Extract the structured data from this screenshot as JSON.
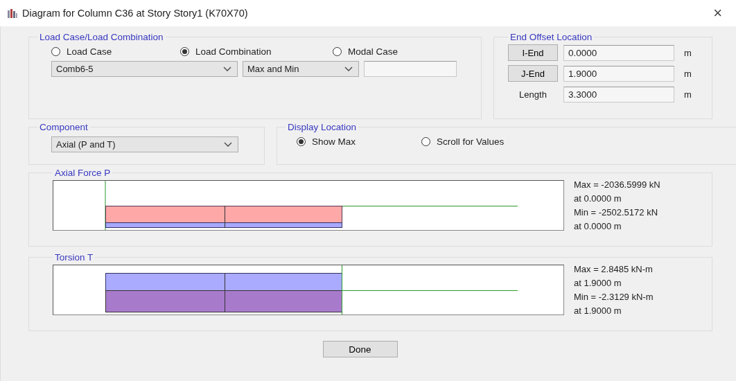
{
  "window": {
    "title": "Diagram for Column C36 at Story Story1 (K70X70)",
    "close": "×"
  },
  "load_case_group": {
    "title": "Load Case/Load Combination",
    "options": [
      {
        "label": "Load Case",
        "selected": false
      },
      {
        "label": "Load Combination",
        "selected": true
      },
      {
        "label": "Modal Case",
        "selected": false
      }
    ],
    "combination": "Comb6-5",
    "mode": "Max and Min"
  },
  "end_offset": {
    "title": "End Offset Location",
    "rows": [
      {
        "kind": "button",
        "label": "I-End",
        "value": "0.0000",
        "unit": "m"
      },
      {
        "kind": "button",
        "label": "J-End",
        "value": "1.9000",
        "unit": "m"
      },
      {
        "kind": "label",
        "label": "Length",
        "value": "3.3000",
        "unit": "m"
      }
    ]
  },
  "component": {
    "title": "Component",
    "value": "Axial (P and T)"
  },
  "display_location": {
    "title": "Display Location",
    "options": [
      {
        "label": "Show Max",
        "selected": true
      },
      {
        "label": "Scroll for Values",
        "selected": false
      }
    ]
  },
  "diagrams": [
    {
      "title": "Axial Force P",
      "kind": "axial",
      "readouts": [
        "Max = -2036.5999 kN",
        "at 0.0000 m",
        "Min = -2502.5172 kN",
        "at 0.0000 m"
      ]
    },
    {
      "title": "Torsion T",
      "kind": "torsion",
      "readouts": [
        "Max = 2.8485 kN-m",
        "at 1.9000 m",
        "Min = -2.3129 kN-m",
        "at 1.9000 m"
      ]
    }
  ],
  "buttons": [
    "Done"
  ]
}
